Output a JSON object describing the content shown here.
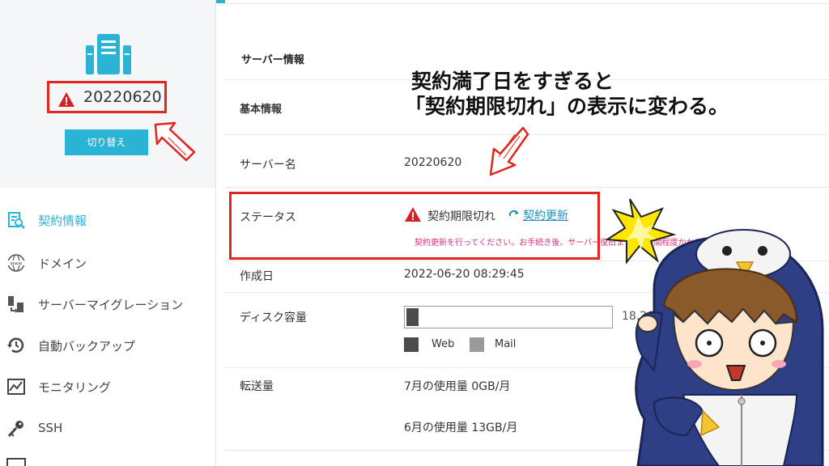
{
  "sidebar": {
    "server_name": "20220620",
    "switch_label": "切り替え",
    "items": [
      {
        "label": "契約情報",
        "icon": "contract-search-icon",
        "active": true
      },
      {
        "label": "ドメイン",
        "icon": "www-icon",
        "active": false
      },
      {
        "label": "サーバーマイグレーション",
        "icon": "migration-icon",
        "active": false
      },
      {
        "label": "自動バックアップ",
        "icon": "backup-clock-icon",
        "active": false
      },
      {
        "label": "モニタリング",
        "icon": "monitoring-chart-icon",
        "active": false
      },
      {
        "label": "SSH",
        "icon": "key-icon",
        "active": false
      }
    ]
  },
  "main": {
    "section_title": "サーバー情報",
    "basic_info_label": "基本情報",
    "server_name_label": "サーバー名",
    "server_name_value": "20220620",
    "status_label": "ステータス",
    "status_value": "契約期限切れ",
    "renew_link": "契約更新",
    "renew_note": "契約更新を行ってください。お手続き後、サーバー復旧までに1時間程度かかる場合がご",
    "created_label": "作成日",
    "created_value": "2022-06-20 08:29:45",
    "disk_label": "ディスク容量",
    "disk_value": "18.26GB/300GB",
    "disk_used_fraction": 0.06,
    "legend_web": "Web",
    "legend_mail": "Mail",
    "transfer_label": "転送量",
    "transfer_july": "7月の使用量 0GB/月",
    "transfer_june": "6月の使用量 13GB/月"
  },
  "annotation": {
    "line1": "契約満了日をすぎると",
    "line2": "「契約期限切れ」の表示に変わる。"
  },
  "colors": {
    "accent": "#2bb3d5",
    "warning": "#e0261f",
    "link": "#1a8fc0",
    "note": "#d6337a"
  }
}
